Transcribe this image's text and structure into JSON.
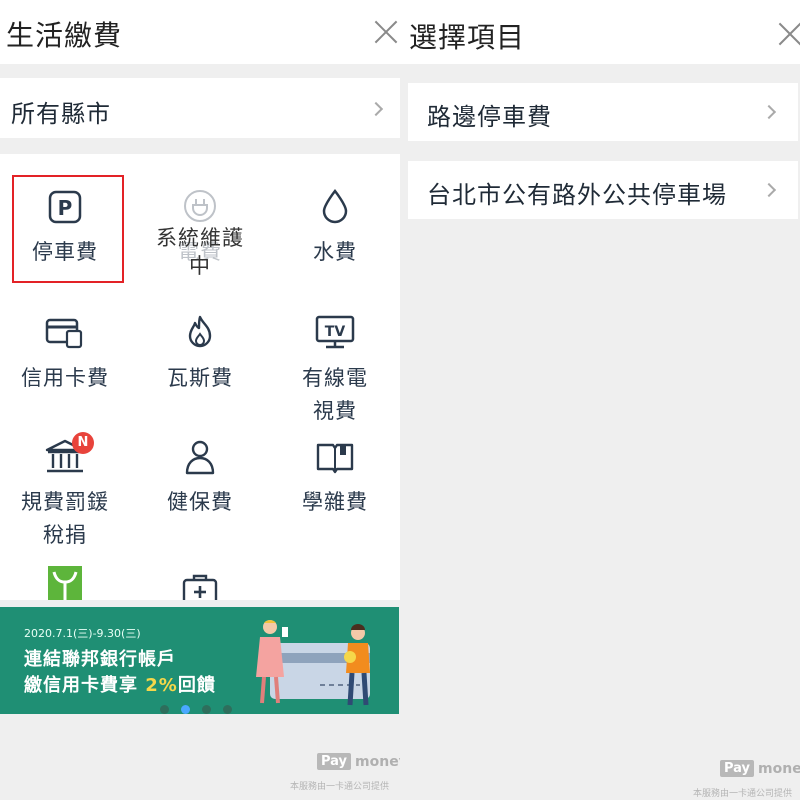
{
  "left": {
    "title": "生活繳費",
    "county": "所有縣市",
    "items": [
      {
        "label": "停車費",
        "icon": "parking-icon"
      },
      {
        "label": "電費",
        "icon": "plug-icon",
        "status": "系統維護中"
      },
      {
        "label": "水費",
        "icon": "water-drop-icon"
      },
      {
        "label": "信用卡費",
        "icon": "credit-card-icon"
      },
      {
        "label": "瓦斯費",
        "icon": "flame-icon"
      },
      {
        "label": "有線電視費",
        "icon": "tv-icon"
      },
      {
        "label": "規費罰鍰稅捐",
        "icon": "government-building-icon",
        "badge": "N"
      },
      {
        "label": "健保費",
        "icon": "person-icon"
      },
      {
        "label": "學雜費",
        "icon": "book-icon"
      }
    ],
    "banner": {
      "date": "2020.7.1(三)-9.30(三)",
      "line1": "連結聯邦銀行帳戶",
      "line2_prefix": "繳信用卡費享 ",
      "line2_pct": "2%",
      "line2_suffix": "回饋",
      "dots": 4,
      "active_dot": 1
    }
  },
  "right": {
    "title": "選擇項目",
    "options": [
      {
        "label": "路邊停車費"
      },
      {
        "label": "台北市公有路外公共停車場"
      }
    ]
  },
  "footer": {
    "logo_pay": "Pay",
    "logo_money": "money",
    "note": "本服務由一卡通公司提供"
  },
  "colors": {
    "accent_green": "#1f8f74",
    "highlight_red": "#e32226",
    "icon_navy": "#2b3a4c",
    "badge_red": "#e8433b"
  }
}
